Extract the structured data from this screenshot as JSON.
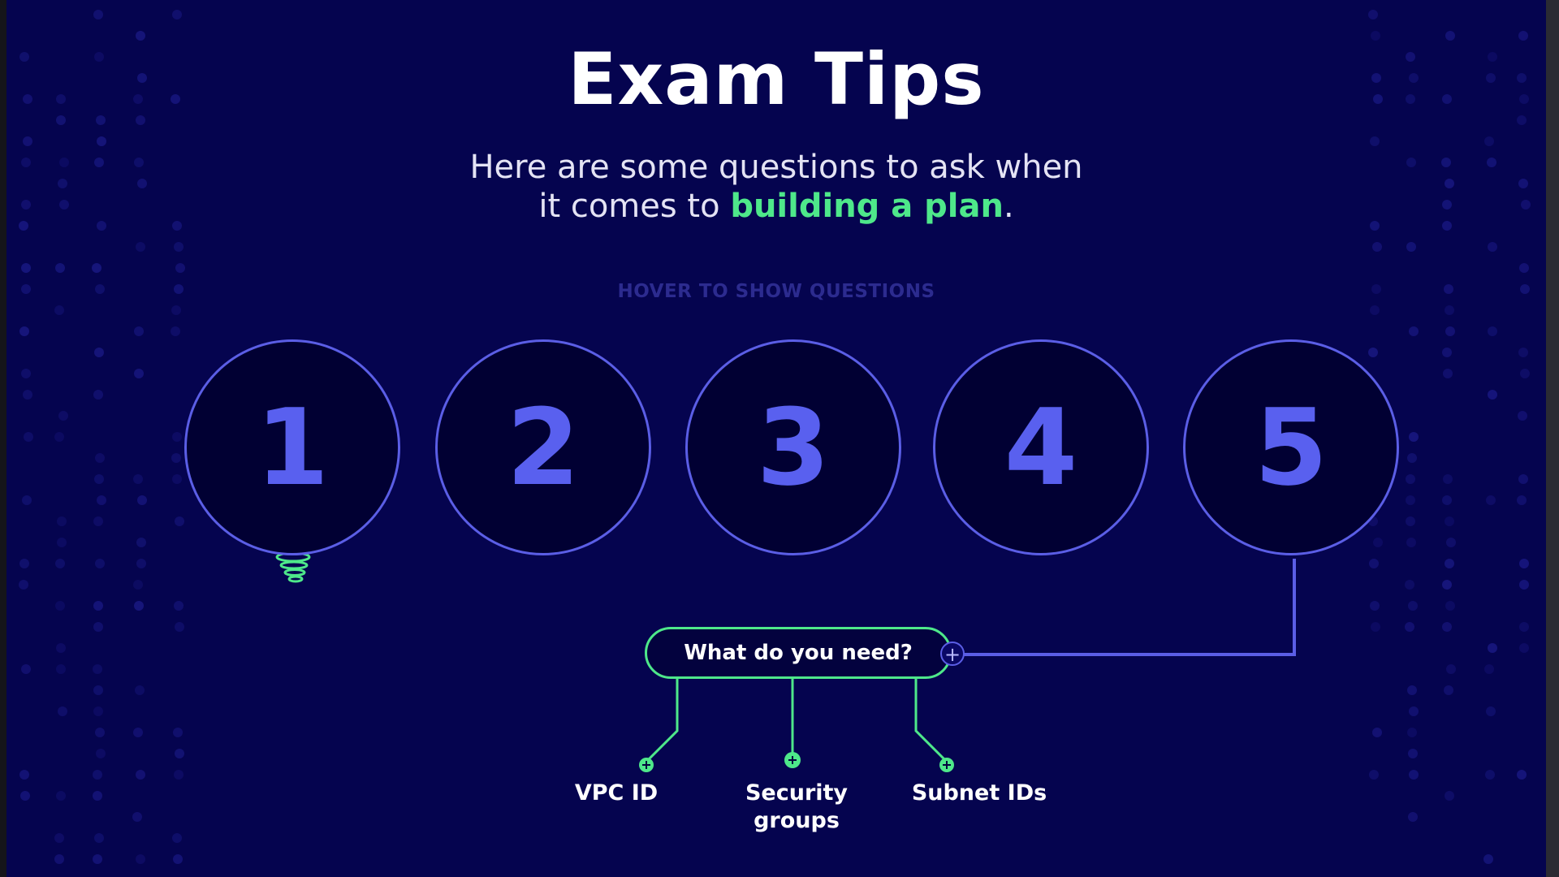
{
  "title": "Exam Tips",
  "subtitle": {
    "line1": "Here are some questions to ask when",
    "line2_prefix": "it comes to ",
    "line2_highlight": "building a plan",
    "line2_suffix": "."
  },
  "hover_hint": "HOVER TO SHOW QUESTIONS",
  "circles": [
    "1",
    "2",
    "3",
    "4",
    "5"
  ],
  "active_circle": "5",
  "question": {
    "label": "What do you need?",
    "answers": [
      "VPC ID",
      "Security groups",
      "Subnet IDs"
    ]
  },
  "colors": {
    "background": "#05044f",
    "accent_blue": "#5b5ee6",
    "accent_green": "#4ee88a",
    "text": "#ffffff"
  },
  "icons": {
    "connector_node": "plus-circle-icon",
    "spring": "green-spring-icon"
  }
}
